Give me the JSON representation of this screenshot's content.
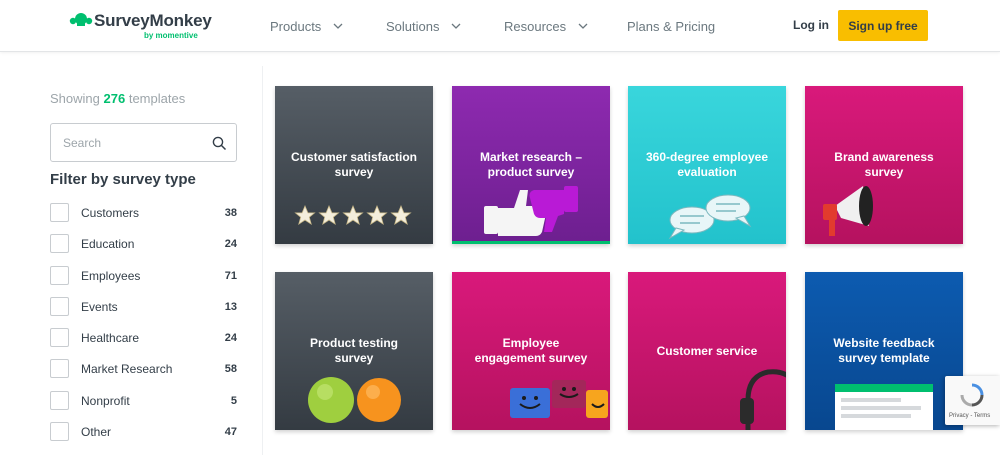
{
  "header": {
    "logo_text": "SurveyMonkey",
    "logo_sub": "by momentive",
    "nav": [
      {
        "label": "Products"
      },
      {
        "label": "Solutions"
      },
      {
        "label": "Resources"
      },
      {
        "label": "Plans & Pricing"
      }
    ],
    "login": "Log in",
    "signup": "Sign up free"
  },
  "sidebar": {
    "showing_prefix": "Showing",
    "showing_count": "276",
    "showing_suffix": "templates",
    "search_placeholder": "Search",
    "filter_title": "Filter by survey type",
    "filters": [
      {
        "label": "Customers",
        "count": "38"
      },
      {
        "label": "Education",
        "count": "24"
      },
      {
        "label": "Employees",
        "count": "71"
      },
      {
        "label": "Events",
        "count": "13"
      },
      {
        "label": "Healthcare",
        "count": "24"
      },
      {
        "label": "Market Research",
        "count": "58"
      },
      {
        "label": "Nonprofit",
        "count": "5"
      },
      {
        "label": "Other",
        "count": "47"
      }
    ]
  },
  "cards": [
    {
      "title_line1": "Customer satisfaction",
      "title_line2": "survey"
    },
    {
      "title_line1": "Market research –",
      "title_line2": "product survey"
    },
    {
      "title_line1": "360-degree employee",
      "title_line2": "evaluation"
    },
    {
      "title_line1": "Brand awareness",
      "title_line2": "survey"
    },
    {
      "title_line1": "Product testing",
      "title_line2": "survey"
    },
    {
      "title_line1": "Employee",
      "title_line2": "engagement survey"
    },
    {
      "title_line1": "Customer service",
      "title_line2": ""
    },
    {
      "title_line1": "Website feedback",
      "title_line2": "survey template"
    }
  ],
  "recaptcha": {
    "text": "Privacy - Terms"
  },
  "colors": {
    "brand_green": "#00bf6f",
    "signup_yellow": "#f9be00",
    "text_dark": "#333e48"
  }
}
